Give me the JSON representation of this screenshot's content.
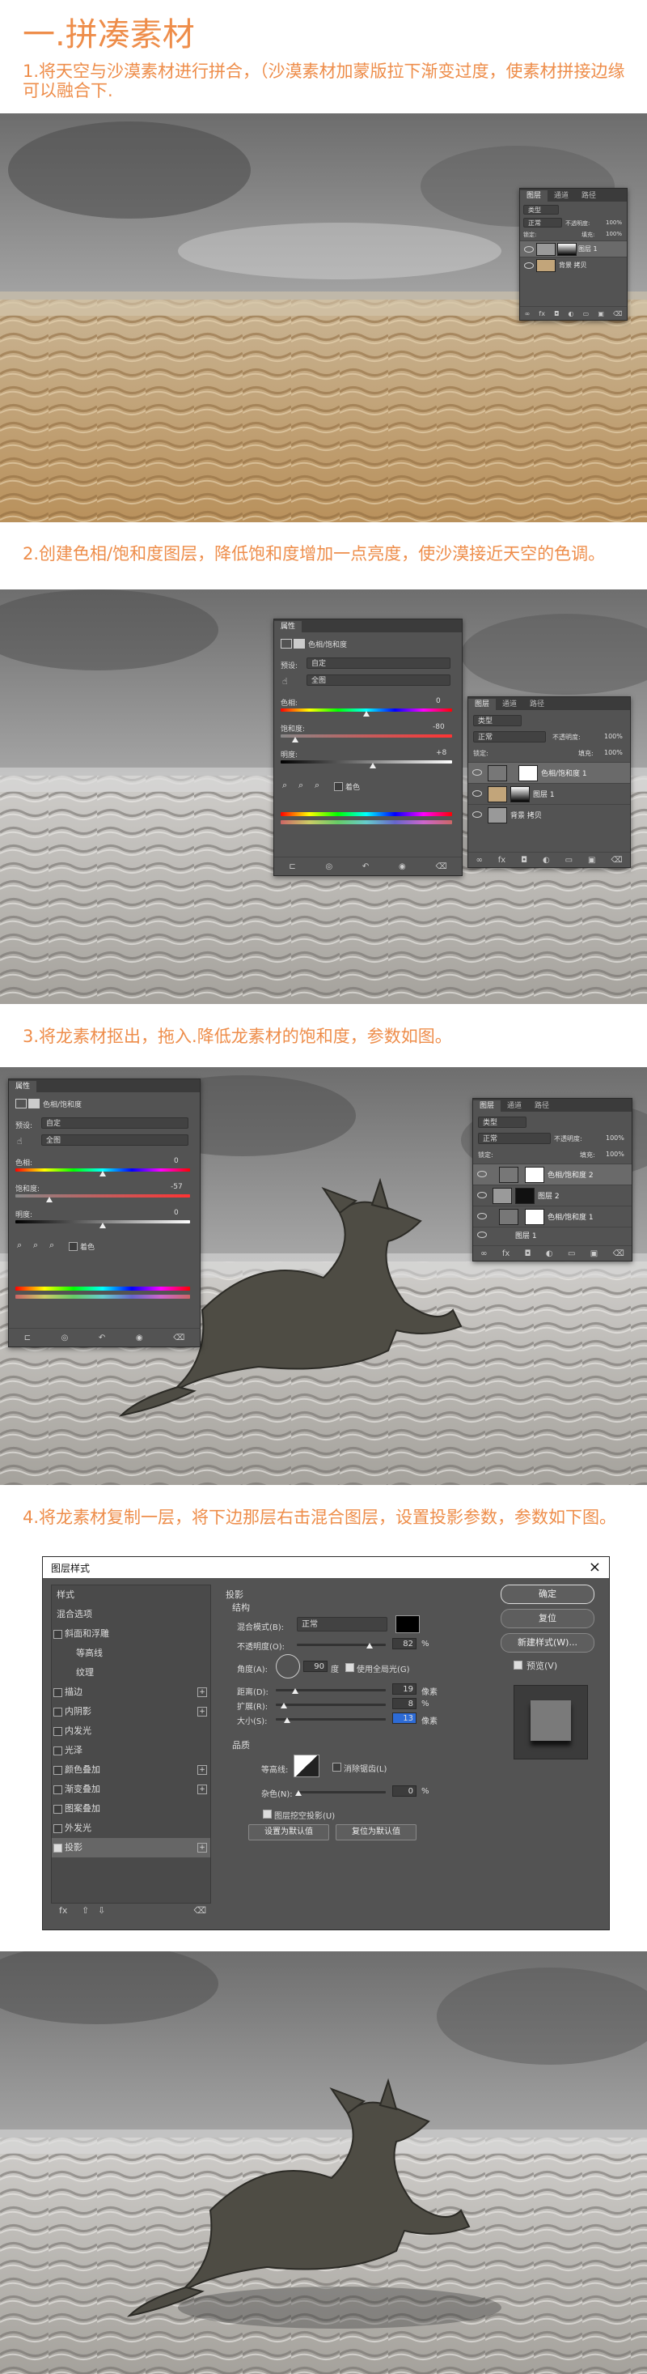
{
  "title": "一.拼凑素材",
  "steps": [
    {
      "text": "1.将天空与沙漠素材进行拼合，（沙漠素材加蒙版拉下渐变过度，使素材拼接边缘可以融合下."
    },
    {
      "text": "2.创建色相/饱和度图层，降低饱和度增加一点亮度，使沙漠接近天空的色调。"
    },
    {
      "text": "3.将龙素材抠出，拖入.降低龙素材的饱和度，参数如图。"
    },
    {
      "text": "4.将龙素材复制一层，将下边那层右击混合图层，设置投影参数，参数如下图。"
    }
  ],
  "layers_panel_1": {
    "tabs": [
      "图层",
      "通道",
      "路径"
    ],
    "kind": "类型",
    "blend": "正常",
    "opacity_label": "不透明度:",
    "opacity": "100%",
    "lock_label": "锁定:",
    "fill_label": "填充:",
    "fill": "100%",
    "layers": [
      {
        "name": "图层 1"
      },
      {
        "name": "背景 拷贝"
      }
    ]
  },
  "props_panel_2": {
    "title": "属性",
    "subtitle": "色相/饱和度",
    "preset_label": "预设:",
    "preset": "自定",
    "channel": "全图",
    "hue_label": "色相:",
    "hue": "0",
    "sat_label": "饱和度:",
    "sat": "-80",
    "light_label": "明度:",
    "light": "+8",
    "colorize": "着色"
  },
  "layers_panel_2": {
    "tabs": [
      "图层",
      "通道",
      "路径"
    ],
    "kind": "类型",
    "blend": "正常",
    "opacity_label": "不透明度:",
    "opacity": "100%",
    "lock_label": "锁定:",
    "fill_label": "填充:",
    "fill": "100%",
    "layers": [
      {
        "name": "色相/饱和度 1"
      },
      {
        "name": "图层 1"
      },
      {
        "name": "背景 拷贝"
      }
    ]
  },
  "props_panel_3": {
    "title": "属性",
    "subtitle": "色相/饱和度",
    "preset_label": "预设:",
    "preset": "自定",
    "channel": "全图",
    "hue_label": "色相:",
    "hue": "0",
    "sat_label": "饱和度:",
    "sat": "-57",
    "light_label": "明度:",
    "light": "0",
    "colorize": "着色"
  },
  "layers_panel_3": {
    "tabs": [
      "图层",
      "通道",
      "路径"
    ],
    "kind": "类型",
    "blend": "正常",
    "opacity_label": "不透明度:",
    "opacity": "100%",
    "lock_label": "锁定:",
    "fill_label": "填充:",
    "fill": "100%",
    "layers": [
      {
        "name": "色相/饱和度 2"
      },
      {
        "name": "图层 2"
      },
      {
        "name": "色相/饱和度 1"
      },
      {
        "name": "图层 1"
      }
    ]
  },
  "dialog": {
    "title": "图层样式",
    "close": "×",
    "styles_header": "样式",
    "blend_options": "混合选项",
    "styles": [
      {
        "name": "斜面和浮雕",
        "checked": false,
        "plus": false
      },
      {
        "name": "等高线",
        "checked": false,
        "plus": false,
        "indent": true
      },
      {
        "name": "纹理",
        "checked": false,
        "plus": false,
        "indent": true
      },
      {
        "name": "描边",
        "checked": false,
        "plus": true
      },
      {
        "name": "内阴影",
        "checked": false,
        "plus": true
      },
      {
        "name": "内发光",
        "checked": false,
        "plus": false
      },
      {
        "name": "光泽",
        "checked": false,
        "plus": false
      },
      {
        "name": "颜色叠加",
        "checked": false,
        "plus": true
      },
      {
        "name": "渐变叠加",
        "checked": false,
        "plus": true
      },
      {
        "name": "图案叠加",
        "checked": false,
        "plus": false
      },
      {
        "name": "外发光",
        "checked": false,
        "plus": false
      },
      {
        "name": "投影",
        "checked": true,
        "plus": true
      }
    ],
    "section": "投影",
    "structure": "结构",
    "blend_mode_label": "混合模式(B):",
    "blend_mode": "正常",
    "opacity_label": "不透明度(O):",
    "opacity": "82",
    "angle_label": "角度(A):",
    "angle": "90",
    "global_light": "使用全局光(G)",
    "distance_label": "距离(D):",
    "distance": "19",
    "spread_label": "扩展(R):",
    "spread": "8",
    "size_label": "大小(S):",
    "size": "13",
    "unit_px": "像素",
    "unit_pct": "%",
    "unit_deg": "度",
    "quality": "品质",
    "contour_label": "等高线:",
    "antialias": "消除锯齿(L)",
    "noise_label": "杂色(N):",
    "noise": "0",
    "knockout": "图层挖空投影(U)",
    "make_default": "设置为默认值",
    "reset_default": "复位为默认值",
    "ok": "确定",
    "reset": "复位",
    "new_style": "新建样式(W)...",
    "preview": "预览(V)",
    "fx": "fx"
  }
}
